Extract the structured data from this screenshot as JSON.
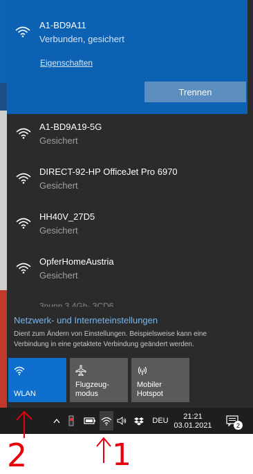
{
  "active_network": {
    "name": "A1-BD9A11",
    "status": "Verbunden, gesichert",
    "properties_link": "Eigenschaften",
    "disconnect_button": "Trennen"
  },
  "networks": [
    {
      "name": "A1-BD9A19-5G",
      "status": "Gesichert"
    },
    {
      "name": "DIRECT-92-HP OfficeJet Pro 6970",
      "status": "Gesichert"
    },
    {
      "name": "HH40V_27D5",
      "status": "Gesichert"
    },
    {
      "name": "OpferHomeAustria",
      "status": "Gesichert"
    }
  ],
  "partial_network": "3nunn 3 4Gh- 3CD6",
  "settings": {
    "link": "Netzwerk- und Interneteinstellungen",
    "description": "Dient zum Ändern von Einstellungen. Beispielsweise kann eine Verbindung in eine getaktete Verbindung geändert werden."
  },
  "quick_actions": {
    "wlan": "WLAN",
    "airplane": "Flugzeug-\nmodus",
    "hotspot": "Mobiler\nHotspot"
  },
  "taskbar": {
    "language": "DEU",
    "time": "21:21",
    "date": "03.01.2021",
    "notification_count": "2"
  },
  "annotations": {
    "left_number": "2",
    "right_number": "1"
  },
  "colors": {
    "active_blue": "#0c61b3",
    "flyout_bg": "#2b2b2b",
    "link_blue": "#77b6ee",
    "annotation_red": "#e8000d"
  }
}
